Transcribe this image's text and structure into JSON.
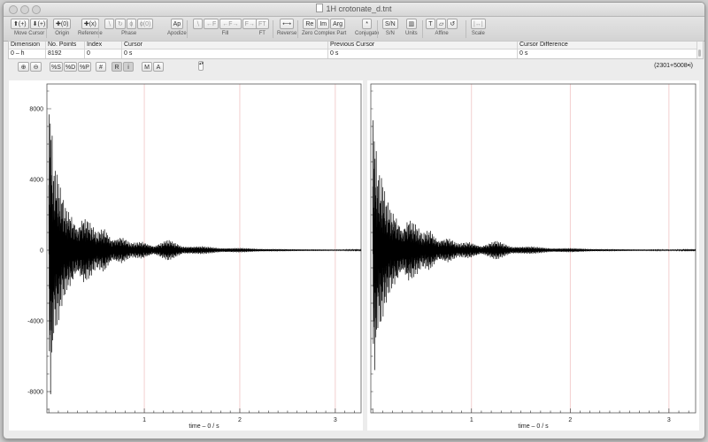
{
  "window": {
    "title": "1H crotonate_d.tnt"
  },
  "toolbar": {
    "groups": [
      {
        "id": "move-cursor",
        "label": "Move Cursor",
        "buttons": [
          "⬆(+)",
          "⬇(+)"
        ],
        "dim": false
      },
      {
        "id": "origin",
        "label": "Origin",
        "buttons": [
          "✚(0)"
        ],
        "dim": false
      },
      {
        "id": "reference",
        "label": "Reference",
        "buttons": [
          "✚(x)"
        ],
        "dim": false
      },
      {
        "id": "phase",
        "label": "Phase",
        "buttons": [
          "∖",
          "↻",
          "ϕ",
          "ϕ(0)"
        ],
        "dim": true
      },
      {
        "id": "apodize",
        "label": "Apodize",
        "buttons": [
          "Ap"
        ],
        "dim": false
      },
      {
        "id": "fill",
        "label": "Fill",
        "buttons": [
          "∖",
          "←F",
          "←F→",
          "F→"
        ],
        "dim": true
      },
      {
        "id": "ft",
        "label": "FT",
        "buttons": [
          "FT"
        ],
        "dim": true
      },
      {
        "id": "reverse",
        "label": "Reverse",
        "buttons": [
          "⟷"
        ],
        "dim": false
      },
      {
        "id": "zero-complex-part",
        "label": "Zero Complex Part",
        "buttons": [
          "Re",
          "Im",
          "Arg"
        ],
        "dim": false
      },
      {
        "id": "conjugate",
        "label": "Conjugate",
        "buttons": [
          "*"
        ],
        "dim": false
      },
      {
        "id": "sn",
        "label": "S/N",
        "buttons": [
          "S/N"
        ],
        "dim": false
      },
      {
        "id": "units",
        "label": "Units",
        "buttons": [
          "▥"
        ],
        "dim": false
      },
      {
        "id": "affine",
        "label": "Affine",
        "buttons": [
          "T",
          "▱",
          "↺"
        ],
        "dim": false
      },
      {
        "id": "scale",
        "label": "Scale",
        "buttons": [
          "|↔|"
        ],
        "dim": true
      }
    ]
  },
  "cursor_table": {
    "columns": [
      {
        "header": "Dimension",
        "value": "0 – h"
      },
      {
        "header": "No. Points",
        "value": "8192"
      },
      {
        "header": "Index",
        "value": "0"
      },
      {
        "header": "Cursor",
        "value": "0 s"
      },
      {
        "header": "Previous Cursor",
        "value": "0 s"
      },
      {
        "header": "Cursor Difference",
        "value": "0 s"
      }
    ]
  },
  "view_controls": {
    "zoom_in": "⊕",
    "zoom_out": "⊖",
    "show_s": "%S",
    "show_d": "%D",
    "show_p": "%P",
    "grid": "#",
    "real": "R",
    "imag": "i",
    "mag": "M",
    "arg": "A",
    "stepper": "▴▾",
    "readout": "(2301+5008•i)"
  },
  "chart_data": [
    {
      "type": "line",
      "title": "",
      "xlabel": "time – 0 / s",
      "ylabel": "",
      "xlim": [
        -0.02,
        3.27
      ],
      "ylim": [
        -9200,
        9400
      ],
      "x_ticks": [
        1,
        2,
        3
      ],
      "y_ticks": [
        8000,
        4000,
        0,
        -4000,
        -8000
      ],
      "grid": "vertical lines at x ticks",
      "series": [
        {
          "style": "decaying oscillating FID (real part)",
          "x": [
            0.0,
            0.02,
            0.05,
            0.09,
            0.13,
            0.18,
            0.24,
            0.3,
            0.36,
            0.42,
            0.5,
            0.58,
            0.66,
            0.76,
            0.86,
            0.98,
            1.1,
            1.25,
            1.4,
            1.6,
            1.8,
            2.0,
            2.2,
            2.5,
            2.8,
            3.1,
            3.27
          ],
          "envelope": [
            8200,
            8500,
            4800,
            4400,
            3300,
            2500,
            2100,
            1400,
            2000,
            1700,
            1000,
            1300,
            650,
            800,
            400,
            500,
            250,
            600,
            220,
            230,
            120,
            130,
            80,
            60,
            45,
            35,
            30
          ]
        }
      ]
    },
    {
      "type": "line",
      "title": "",
      "xlabel": "time – 0 / s",
      "ylabel": "",
      "xlim": [
        -0.02,
        3.27
      ],
      "ylim": [
        -9200,
        9400
      ],
      "x_ticks": [
        1,
        2,
        3
      ],
      "grid": "vertical lines at x ticks",
      "series": [
        {
          "style": "decaying oscillating FID (imaginary part)",
          "x": [
            0.0,
            0.02,
            0.05,
            0.09,
            0.13,
            0.18,
            0.24,
            0.3,
            0.36,
            0.42,
            0.5,
            0.58,
            0.66,
            0.76,
            0.86,
            0.98,
            1.1,
            1.25,
            1.4,
            1.6,
            1.8,
            2.0,
            2.2,
            2.5,
            2.8,
            3.1,
            3.27
          ],
          "envelope": [
            8000,
            7000,
            4500,
            4200,
            3100,
            2400,
            2000,
            1300,
            1900,
            1600,
            950,
            1200,
            600,
            750,
            380,
            480,
            240,
            550,
            210,
            220,
            110,
            120,
            75,
            55,
            42,
            33,
            28
          ]
        }
      ]
    }
  ]
}
